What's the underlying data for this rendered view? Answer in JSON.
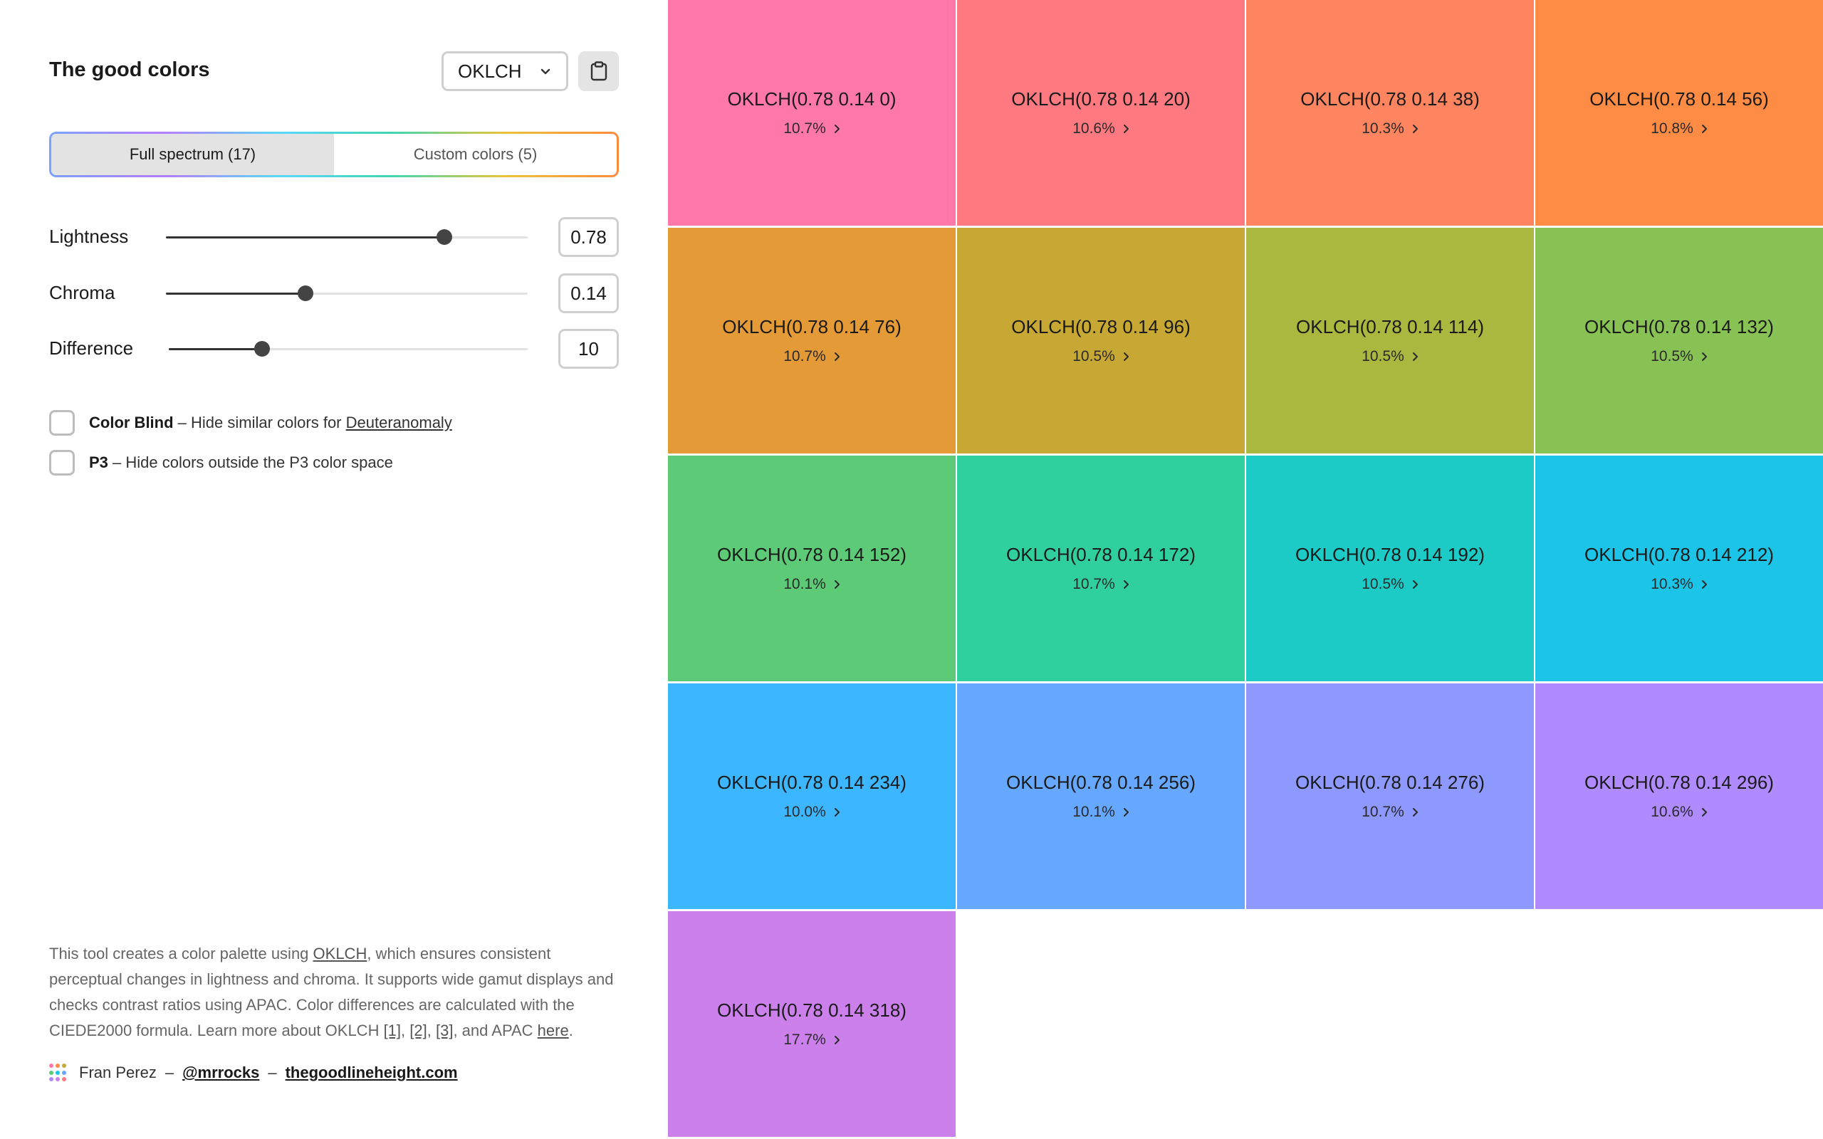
{
  "app": {
    "title": "The good colors"
  },
  "format_select": {
    "value": "OKLCH"
  },
  "tabs": [
    {
      "label": "Full spectrum (17)",
      "active": true
    },
    {
      "label": "Custom colors (5)",
      "active": false
    }
  ],
  "sliders": [
    {
      "label": "Lightness",
      "value": "0.78",
      "fraction": 0.77
    },
    {
      "label": "Chroma",
      "value": "0.14",
      "fraction": 0.385
    },
    {
      "label": "Difference",
      "value": "10",
      "fraction": 0.26
    }
  ],
  "checks": {
    "color_blind": {
      "bold": "Color Blind",
      "text": " – Hide similar colors for ",
      "link": "Deuteranomaly"
    },
    "p3": {
      "bold": "P3",
      "text": " – Hide colors outside the P3 color space"
    }
  },
  "about": {
    "t1": "This tool creates a color palette using ",
    "l1": "OKLCH",
    "t2": ", which ensures consistent perceptual changes in lightness and chroma. It supports wide gamut displays and checks contrast ratios using APAC. Color differences are calculated with the CIEDE2000 formula. Learn more about OKLCH ",
    "r1": "[1]",
    "c1": ", ",
    "r2": "[2]",
    "c2": ", ",
    "r3": "[3]",
    "t3": ", and APAC ",
    "here": "here",
    "end": "."
  },
  "credits": {
    "author": "Fran Perez",
    "dash1": "–",
    "handle": "@mrrocks",
    "dash2": "–",
    "site": "thegoodlineheight.com"
  },
  "icons": {
    "format_chevron": "chevron-down-icon",
    "copy": "clipboard-icon",
    "credits": "palette-dots-icon",
    "contrast_arrow": "chevron-right-icon"
  },
  "swatches": [
    {
      "label": "OKLCH(0.78 0.14 0)",
      "contrast": "10.7%",
      "color": "#ff78a8"
    },
    {
      "label": "OKLCH(0.78 0.14 20)",
      "contrast": "10.6%",
      "color": "#ff7a80"
    },
    {
      "label": "OKLCH(0.78 0.14 38)",
      "contrast": "10.3%",
      "color": "#ff8460"
    },
    {
      "label": "OKLCH(0.78 0.14 56)",
      "contrast": "10.8%",
      "color": "#ff8c44"
    },
    {
      "label": "OKLCH(0.78 0.14 76)",
      "contrast": "10.7%",
      "color": "#e39a37"
    },
    {
      "label": "OKLCH(0.78 0.14 96)",
      "contrast": "10.5%",
      "color": "#c8a834"
    },
    {
      "label": "OKLCH(0.78 0.14 114)",
      "contrast": "10.5%",
      "color": "#aab840"
    },
    {
      "label": "OKLCH(0.78 0.14 132)",
      "contrast": "10.5%",
      "color": "#88c255"
    },
    {
      "label": "OKLCH(0.78 0.14 152)",
      "contrast": "10.1%",
      "color": "#5cca77"
    },
    {
      "label": "OKLCH(0.78 0.14 172)",
      "contrast": "10.7%",
      "color": "#30d09c"
    },
    {
      "label": "OKLCH(0.78 0.14 192)",
      "contrast": "10.5%",
      "color": "#1ccbc6"
    },
    {
      "label": "OKLCH(0.78 0.14 212)",
      "contrast": "10.3%",
      "color": "#1cc4e8"
    },
    {
      "label": "OKLCH(0.78 0.14 234)",
      "contrast": "10.0%",
      "color": "#3bb6ff"
    },
    {
      "label": "OKLCH(0.78 0.14 256)",
      "contrast": "10.1%",
      "color": "#66a8ff"
    },
    {
      "label": "OKLCH(0.78 0.14 276)",
      "contrast": "10.7%",
      "color": "#8e99ff"
    },
    {
      "label": "OKLCH(0.78 0.14 296)",
      "contrast": "10.6%",
      "color": "#b08aff"
    },
    {
      "label": "OKLCH(0.78 0.14 318)",
      "contrast": "17.7%",
      "color": "#cc80ec"
    }
  ]
}
